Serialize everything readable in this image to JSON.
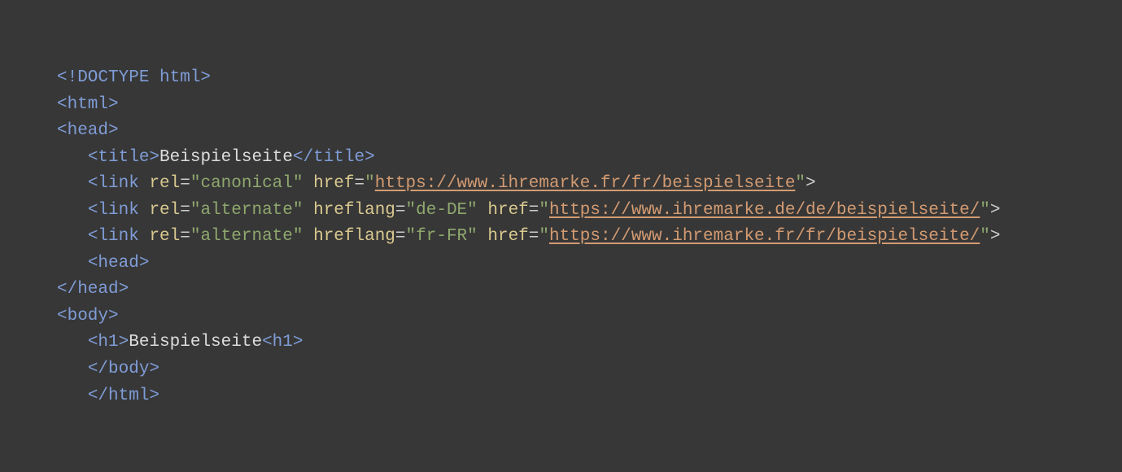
{
  "code": {
    "doctype": "<!DOCTYPE html>",
    "html_open": "<html>",
    "head_open": "<head>",
    "title_open": "<title>",
    "title_text": "Beispielseite",
    "title_close": "</title>",
    "link1_open": "<link",
    "rel_attr": "rel",
    "canonical_val": "\"canonical\"",
    "href_attr": "href",
    "link1_url": "https://www.ihremarke.fr/fr/beispielseite",
    "link2_open": "<link",
    "alternate_val": "\"alternate\"",
    "hreflang_attr": "hreflang",
    "hreflang_de": "\"de-DE\"",
    "link2_url": "https://www.ihremarke.de/de/beispielseite/",
    "link3_open": "<link",
    "hreflang_fr": "\"fr-FR\"",
    "link3_url": "https://www.ihremarke.fr/fr/beispielseite/",
    "head_inner": "<head>",
    "head_close": "</head>",
    "body_open": "<body>",
    "h1_open": "<h1>",
    "h1_text": "Beispielseite",
    "h1_close": "<h1>",
    "body_close": "</body>",
    "html_close": "</html>",
    "eq": "=",
    "q": "\"",
    "gt": ">",
    "sp": " "
  }
}
